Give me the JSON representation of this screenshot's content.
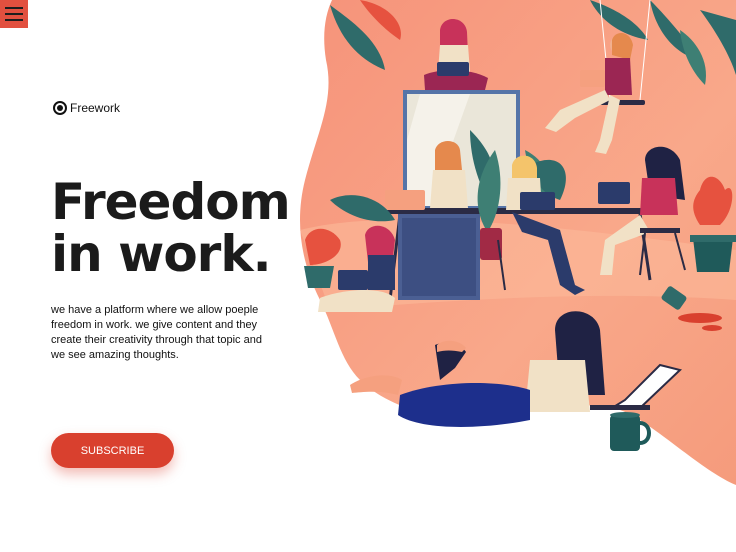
{
  "brand": {
    "name": "Freework",
    "icon": "radio-logo-icon",
    "accent_color": "#d9402e"
  },
  "header": {
    "menu_icon": "hamburger-menu-icon"
  },
  "hero": {
    "title_line1": "Freedom",
    "title_line2": "in work.",
    "description": "we have a platform where we allow poeple freedom in work. we give content and they create their creativity through that topic and we see amazing thoughts.",
    "subscribe_label": "SUBSCRIBE"
  },
  "illustration": {
    "name": "people-working-illustration",
    "background_color": "#f8a07e"
  }
}
